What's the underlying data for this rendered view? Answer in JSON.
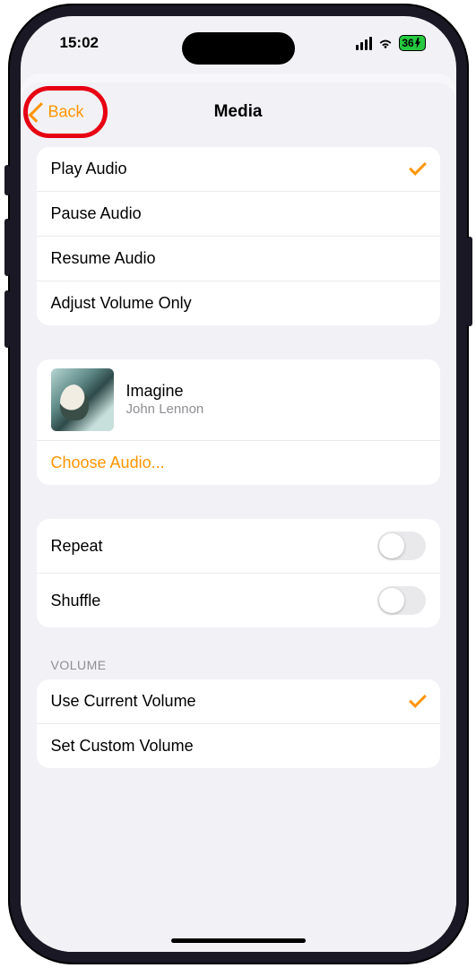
{
  "status": {
    "time": "15:02",
    "battery": "36"
  },
  "nav": {
    "back_label": "Back",
    "title": "Media"
  },
  "actions": {
    "play": "Play Audio",
    "pause": "Pause Audio",
    "resume": "Resume Audio",
    "adjust": "Adjust Volume Only"
  },
  "media": {
    "song": "Imagine",
    "artist": "John Lennon",
    "choose_label": "Choose Audio..."
  },
  "toggles": {
    "repeat": "Repeat",
    "shuffle": "Shuffle"
  },
  "volume": {
    "section_label": "VOLUME",
    "use_current": "Use Current Volume",
    "set_custom": "Set Custom Volume"
  }
}
